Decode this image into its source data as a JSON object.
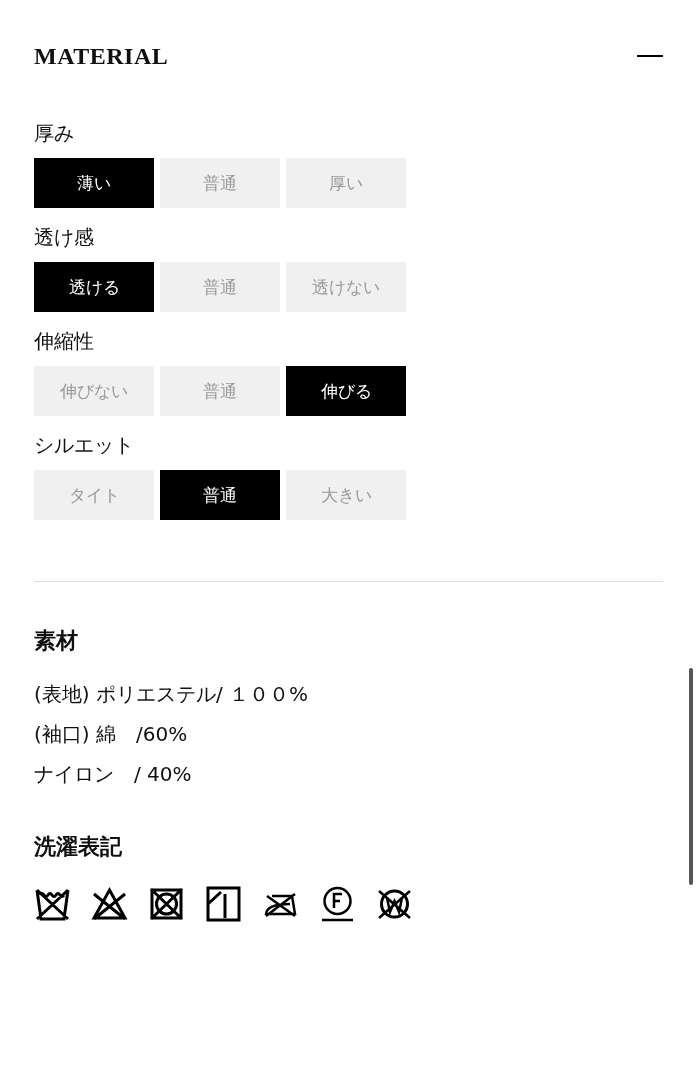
{
  "title": "MATERIAL",
  "ratings": [
    {
      "label": "厚み",
      "options": [
        {
          "label": "薄い",
          "selected": true
        },
        {
          "label": "普通",
          "selected": false
        },
        {
          "label": "厚い",
          "selected": false
        }
      ]
    },
    {
      "label": "透け感",
      "options": [
        {
          "label": "透ける",
          "selected": true
        },
        {
          "label": "普通",
          "selected": false
        },
        {
          "label": "透けない",
          "selected": false
        }
      ]
    },
    {
      "label": "伸縮性",
      "options": [
        {
          "label": "伸びない",
          "selected": false
        },
        {
          "label": "普通",
          "selected": false
        },
        {
          "label": "伸びる",
          "selected": true
        }
      ]
    },
    {
      "label": "シルエット",
      "options": [
        {
          "label": "タイト",
          "selected": false
        },
        {
          "label": "普通",
          "selected": true
        },
        {
          "label": "大きい",
          "selected": false
        }
      ]
    }
  ],
  "material": {
    "heading": "素材",
    "lines": [
      "(表地) ポリエステル/ １００%",
      "(袖口) 綿　/60%",
      "ナイロン　/ 40%"
    ]
  },
  "care": {
    "heading": "洗濯表記"
  }
}
